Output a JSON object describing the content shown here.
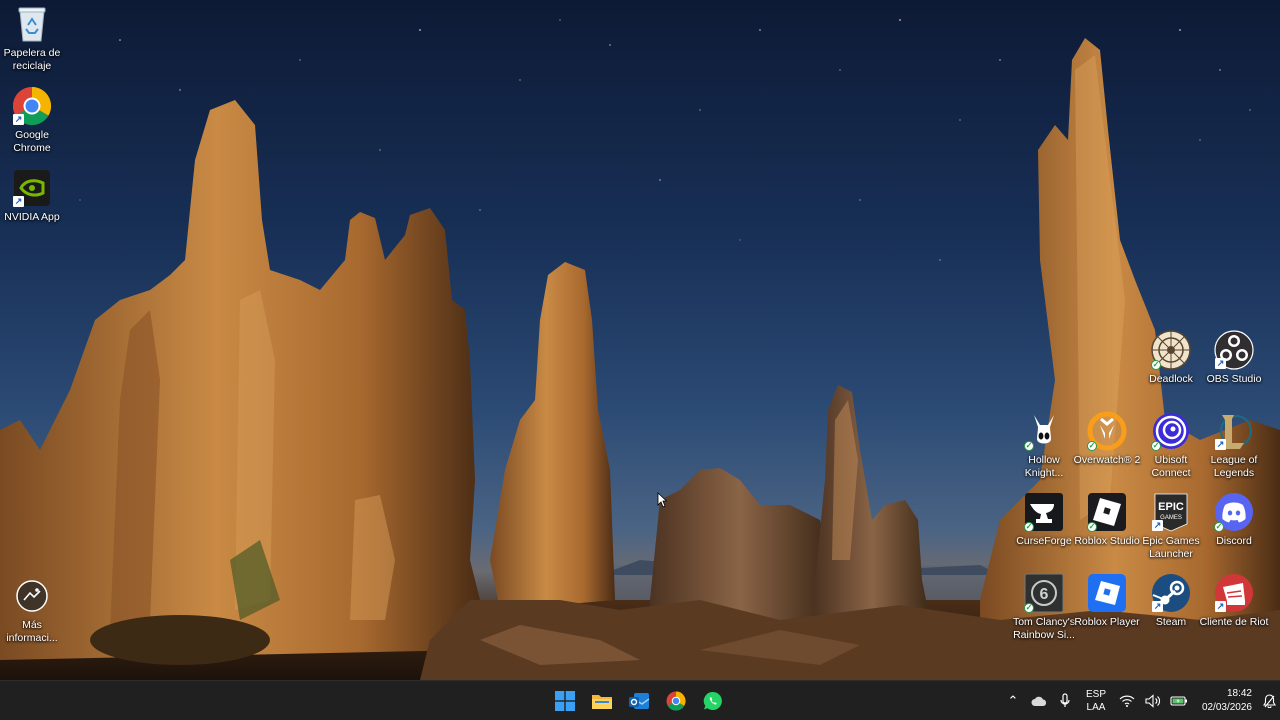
{
  "desktop": {
    "left_icons": [
      {
        "name": "recycle-bin",
        "label": "Papelera de reciclaje"
      },
      {
        "name": "google-chrome",
        "label": "Google Chrome"
      },
      {
        "name": "nvidia-app",
        "label": "NVIDIA App"
      },
      {
        "name": "mas-informacion",
        "label": "Más informaci..."
      }
    ],
    "right_icons": [
      {
        "name": "deadlock",
        "label": "Deadlock"
      },
      {
        "name": "obs-studio",
        "label": "OBS Studio"
      },
      {
        "name": "hollow-knight",
        "label": "Hollow Knight..."
      },
      {
        "name": "overwatch-2",
        "label": "Overwatch® 2"
      },
      {
        "name": "ubisoft-connect",
        "label": "Ubisoft Connect"
      },
      {
        "name": "league-of-legends",
        "label": "League of Legends"
      },
      {
        "name": "curseforge",
        "label": "CurseForge"
      },
      {
        "name": "roblox-studio",
        "label": "Roblox Studio"
      },
      {
        "name": "epic-games-launcher",
        "label": "Epic Games Launcher"
      },
      {
        "name": "discord",
        "label": "Discord"
      },
      {
        "name": "rainbow-six",
        "label": "Tom Clancy's Rainbow Si..."
      },
      {
        "name": "roblox-player",
        "label": "Roblox Player"
      },
      {
        "name": "steam",
        "label": "Steam"
      },
      {
        "name": "riot-client",
        "label": "Cliente de Riot"
      }
    ],
    "icon_glyphs": {
      "epic_text": "EPIC",
      "epic_sub": "GAMES",
      "r6_text": "6"
    }
  },
  "taskbar": {
    "pinned": [
      "windows-start-icon",
      "file-explorer-icon",
      "outlook-icon",
      "chrome-icon",
      "whatsapp-icon"
    ],
    "tray": {
      "lang_line1": "ESP",
      "lang_line2": "LAA",
      "time": "18:42",
      "date": "02/03/2026"
    }
  },
  "colors": {
    "taskbar_bg": "#202020",
    "discord": "#5865f2",
    "roblox_blue": "#1f6ff2",
    "riot_red": "#d13639"
  }
}
